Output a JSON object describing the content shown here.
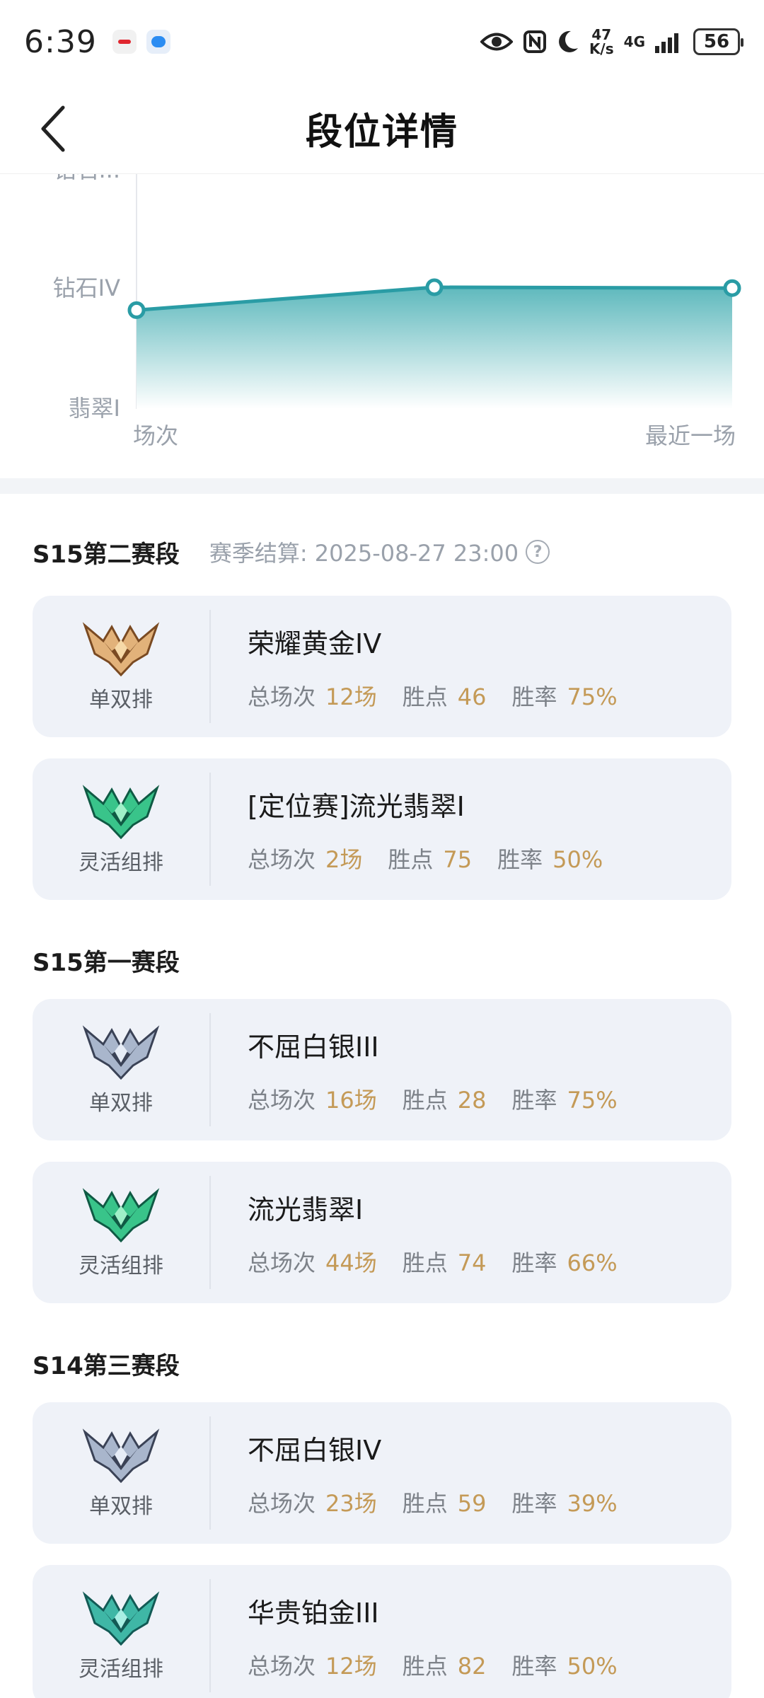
{
  "status_bar": {
    "time": "6:39",
    "network_speed_top": "47",
    "network_speed_bottom": "K/s",
    "network_type": "4G",
    "battery": "56"
  },
  "header": {
    "title": "段位详情"
  },
  "chart_data": {
    "type": "area",
    "y_ticks": [
      "钻石...",
      "钻石IV",
      "翡翠I"
    ],
    "xlabel_left": "场次",
    "xlabel_right": "最近一场",
    "points": [
      {
        "x": 0,
        "y": 0.27
      },
      {
        "x": 0.5,
        "y": 0
      },
      {
        "x": 1,
        "y": 0.01
      }
    ],
    "colors": {
      "line": "#2a9ca5",
      "fill_top": "#5fb9bd",
      "fill_bottom": "#ffffff"
    }
  },
  "seasons": [
    {
      "name": "S15第二赛段",
      "end_label": "赛季结算: 2025-08-27 23:00",
      "help_icon": "question-circle-icon",
      "ranks": [
        {
          "queue": "单双排",
          "emblem": "gold",
          "rank": "荣耀黄金IV",
          "games_label": "总场次",
          "games": "12场",
          "lp_label": "胜点",
          "lp": "46",
          "wr_label": "胜率",
          "wr": "75%"
        },
        {
          "queue": "灵活组排",
          "emblem": "emerald",
          "rank": "[定位赛]流光翡翠I",
          "games_label": "总场次",
          "games": "2场",
          "lp_label": "胜点",
          "lp": "75",
          "wr_label": "胜率",
          "wr": "50%"
        }
      ]
    },
    {
      "name": "S15第一赛段",
      "ranks": [
        {
          "queue": "单双排",
          "emblem": "silver",
          "rank": "不屈白银III",
          "games_label": "总场次",
          "games": "16场",
          "lp_label": "胜点",
          "lp": "28",
          "wr_label": "胜率",
          "wr": "75%"
        },
        {
          "queue": "灵活组排",
          "emblem": "emerald",
          "rank": "流光翡翠I",
          "games_label": "总场次",
          "games": "44场",
          "lp_label": "胜点",
          "lp": "74",
          "wr_label": "胜率",
          "wr": "66%"
        }
      ]
    },
    {
      "name": "S14第三赛段",
      "ranks": [
        {
          "queue": "单双排",
          "emblem": "silver",
          "rank": "不屈白银IV",
          "games_label": "总场次",
          "games": "23场",
          "lp_label": "胜点",
          "lp": "59",
          "wr_label": "胜率",
          "wr": "39%"
        },
        {
          "queue": "灵活组排",
          "emblem": "platinum",
          "rank": "华贵铂金III",
          "games_label": "总场次",
          "games": "12场",
          "lp_label": "胜点",
          "lp": "82",
          "wr_label": "胜率",
          "wr": "50%"
        }
      ]
    }
  ]
}
